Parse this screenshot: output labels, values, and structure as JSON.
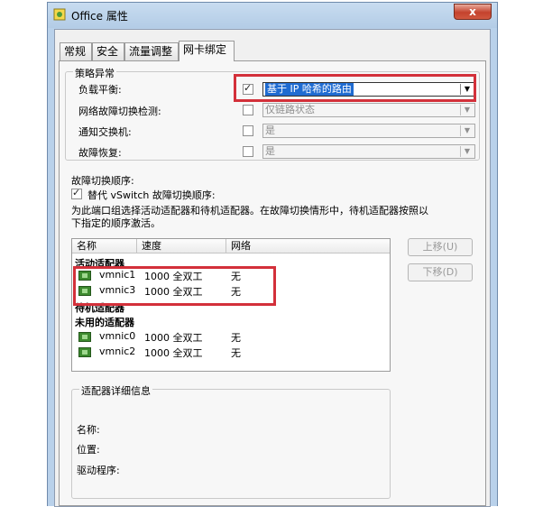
{
  "window": {
    "title": "Office 属性",
    "close_glyph": "x"
  },
  "tabs": [
    "常规",
    "安全",
    "流量调整",
    "网卡绑定"
  ],
  "policy": {
    "legend": "策略异常",
    "rows": [
      {
        "label": "负载平衡:",
        "checked": true,
        "value": "基于 IP 哈希的路由",
        "enabled": true
      },
      {
        "label": "网络故障切换检测:",
        "checked": false,
        "value": "仅链路状态",
        "enabled": false
      },
      {
        "label": "通知交换机:",
        "checked": false,
        "value": "是",
        "enabled": false
      },
      {
        "label": "故障恢复:",
        "checked": false,
        "value": "是",
        "enabled": false
      }
    ]
  },
  "failover": {
    "title": "故障切换顺序:",
    "override_label": "替代 vSwitch 故障切换顺序:",
    "override_checked": true,
    "description_line1": "为此端口组选择活动适配器和待机适配器。在故障切换情形中，待机适配器按照以",
    "description_line2": "下指定的顺序激活。"
  },
  "adapter_list": {
    "columns": [
      "名称",
      "速度",
      "网络"
    ],
    "groups": [
      {
        "name": "活动适配器",
        "adapters": [
          {
            "name": "vmnic1",
            "speed": "1000 全双工",
            "network": "无"
          },
          {
            "name": "vmnic3",
            "speed": "1000 全双工",
            "network": "无"
          }
        ]
      },
      {
        "name": "待机适配器",
        "adapters": []
      },
      {
        "name": "未用的适配器",
        "adapters": [
          {
            "name": "vmnic0",
            "speed": "1000 全双工",
            "network": "无"
          },
          {
            "name": "vmnic2",
            "speed": "1000 全双工",
            "network": "无"
          }
        ]
      }
    ]
  },
  "buttons": {
    "move_up": "上移(U)",
    "move_down": "下移(D)"
  },
  "details": {
    "legend": "适配器详细信息",
    "name_label": "名称:",
    "location_label": "位置:",
    "driver_label": "驱动程序:"
  },
  "colors": {
    "highlight": "#d3303a",
    "selection": "#1f6bd1",
    "nic_icon": "#3d8a2f"
  }
}
